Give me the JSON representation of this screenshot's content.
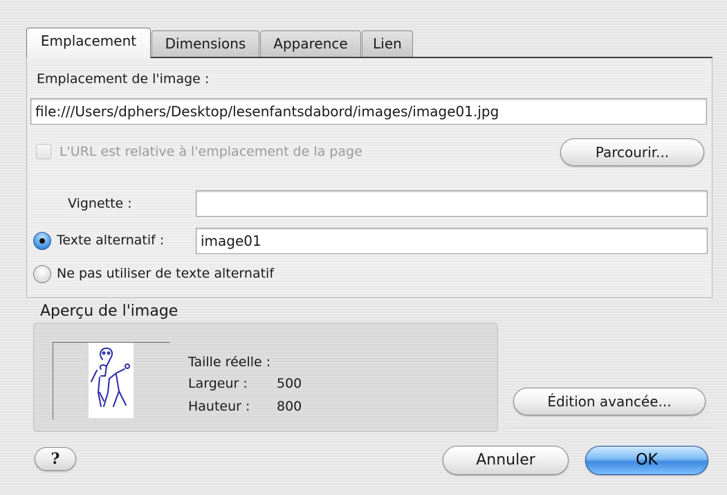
{
  "tabs": [
    {
      "label": "Emplacement",
      "active": true
    },
    {
      "label": "Dimensions",
      "active": false
    },
    {
      "label": "Apparence",
      "active": false
    },
    {
      "label": "Lien",
      "active": false
    }
  ],
  "location": {
    "label": "Emplacement de l'image :",
    "url_value": "file:///Users/dphers/Desktop/lesenfantsdabord/images/image01.jpg",
    "relative_checkbox_label": "L'URL est relative à l'emplacement de la page",
    "relative_checked": false,
    "relative_enabled": false,
    "browse_label": "Parcourir..."
  },
  "tooltip": {
    "label": "Vignette :",
    "value": ""
  },
  "alt": {
    "alt_text_label": "Texte alternatif :",
    "alt_text_value": "image01",
    "alt_text_selected": true,
    "no_alt_label": "Ne pas utiliser de texte alternatif",
    "no_alt_selected": false
  },
  "preview": {
    "heading": "Aperçu de l'image",
    "actual_size_label": "Taille réelle :",
    "width_label": "Largeur :",
    "width_value": "500",
    "height_label": "Hauteur :",
    "height_value": "800",
    "advanced_edit_label": "Édition avancée..."
  },
  "footer": {
    "help_label": "?",
    "cancel_label": "Annuler",
    "ok_label": "OK"
  },
  "colors": {
    "default_button": "#3f8ae0",
    "sketch_stroke": "#2a2aa8"
  }
}
